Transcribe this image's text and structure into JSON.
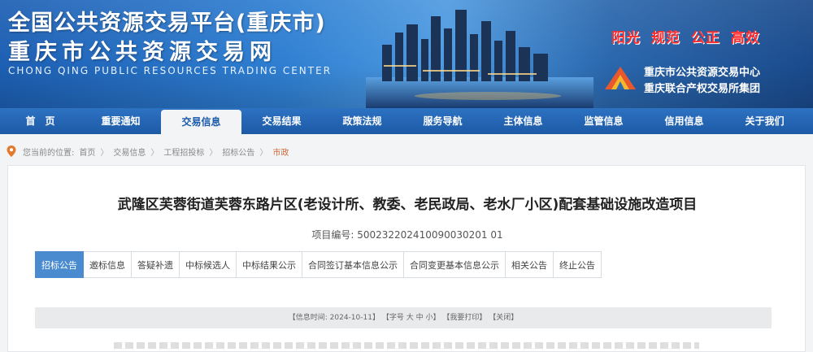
{
  "header": {
    "title_line1": "全国公共资源交易平台(重庆市)",
    "title_line2": "重庆市公共资源交易网",
    "title_en": "CHONG QING PUBLIC RESOURCES TRADING CENTER",
    "slogan": "阳光  规范  公正  高效",
    "org_line1": "重庆市公共资源交易中心",
    "org_line2": "重庆联合产权交易所集团"
  },
  "nav": {
    "items": [
      "首　页",
      "重要通知",
      "交易信息",
      "交易结果",
      "政策法规",
      "服务导航",
      "主体信息",
      "监管信息",
      "信用信息",
      "关于我们"
    ],
    "active_index": 2
  },
  "breadcrumb": {
    "prefix": "您当前的位置:",
    "items": [
      "首页",
      "交易信息",
      "工程招投标",
      "招标公告",
      "市政"
    ]
  },
  "project": {
    "title": "武隆区芙蓉街道芙蓉东路片区(老设计所、教委、老民政局、老水厂小区)配套基础设施改造项目",
    "code_label": "项目编号:",
    "code_value": "500232202410090030201 01"
  },
  "tabs": {
    "items": [
      "招标公告",
      "邀标信息",
      "答疑补遗",
      "中标候选人",
      "中标结果公示",
      "合同签订基本信息公示",
      "合同变更基本信息公示",
      "相关公告",
      "终止公告"
    ],
    "active_index": 0
  },
  "infobar": {
    "time_label": "【信息时间: 2024-10-11】",
    "font_label": "【字号",
    "font_sizes": "大 中 小】",
    "print_label": "【我要打印】",
    "close_label": "【关闭】"
  },
  "colors": {
    "nav_bg": "#1d5aa6",
    "tab_active": "#4a8bd0",
    "slogan": "#ff2e2e",
    "crumb_last": "#d06a3c"
  }
}
